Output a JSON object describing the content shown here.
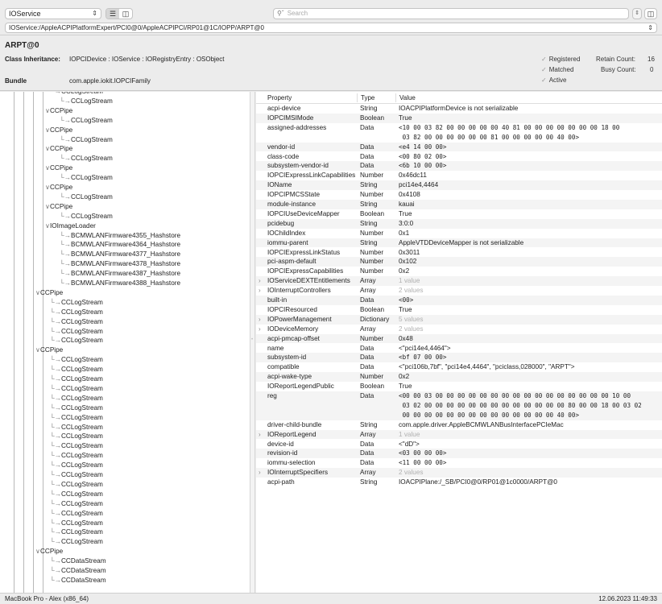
{
  "toolbar": {
    "plane": "IOService",
    "search_placeholder": "Search",
    "path": "IOService:/AppleACPIPlatformExpert/PCI0@0/AppleACPIPCI/RP01@1C/IOPP/ARPT@0"
  },
  "info": {
    "object_name": "ARPT@0",
    "class_inheritance_label": "Class Inheritance:",
    "class_inheritance": "IOPCIDevice : IOService : IORegistryEntry : OSObject",
    "bundle_label": "Bundle",
    "bundle": "com.apple.iokit.IOPCIFamily",
    "flags": [
      "Registered",
      "Matched",
      "Active"
    ],
    "retain_label": "Retain Count:",
    "retain_count": "16",
    "busy_label": "Busy Count:",
    "busy_count": "0"
  },
  "tree": [
    {
      "label": "CCLogStream",
      "depth": 5,
      "twisty": ""
    },
    {
      "label": "CCLogStream",
      "depth": 6,
      "twisty": ""
    },
    {
      "label": "CCPipe",
      "depth": 5,
      "twisty": "open"
    },
    {
      "label": "CCLogStream",
      "depth": 6,
      "twisty": ""
    },
    {
      "label": "CCPipe",
      "depth": 5,
      "twisty": "open"
    },
    {
      "label": "CCLogStream",
      "depth": 6,
      "twisty": ""
    },
    {
      "label": "CCPipe",
      "depth": 5,
      "twisty": "open"
    },
    {
      "label": "CCLogStream",
      "depth": 6,
      "twisty": ""
    },
    {
      "label": "CCPipe",
      "depth": 5,
      "twisty": "open"
    },
    {
      "label": "CCLogStream",
      "depth": 6,
      "twisty": ""
    },
    {
      "label": "CCPipe",
      "depth": 5,
      "twisty": "open"
    },
    {
      "label": "CCLogStream",
      "depth": 6,
      "twisty": ""
    },
    {
      "label": "CCPipe",
      "depth": 5,
      "twisty": "open"
    },
    {
      "label": "CCLogStream",
      "depth": 6,
      "twisty": ""
    },
    {
      "label": "IOImageLoader",
      "depth": 5,
      "twisty": "open"
    },
    {
      "label": "BCMWLANFirmware4355_Hashstore",
      "depth": 6,
      "twisty": ""
    },
    {
      "label": "BCMWLANFirmware4364_Hashstore",
      "depth": 6,
      "twisty": ""
    },
    {
      "label": "BCMWLANFirmware4377_Hashstore",
      "depth": 6,
      "twisty": ""
    },
    {
      "label": "BCMWLANFirmware4378_Hashstore",
      "depth": 6,
      "twisty": ""
    },
    {
      "label": "BCMWLANFirmware4387_Hashstore",
      "depth": 6,
      "twisty": ""
    },
    {
      "label": "BCMWLANFirmware4388_Hashstore",
      "depth": 6,
      "twisty": ""
    },
    {
      "label": "CCPipe",
      "depth": 4,
      "twisty": "open"
    },
    {
      "label": "CCLogStream",
      "depth": 5,
      "twisty": ""
    },
    {
      "label": "CCLogStream",
      "depth": 5,
      "twisty": ""
    },
    {
      "label": "CCLogStream",
      "depth": 5,
      "twisty": ""
    },
    {
      "label": "CCLogStream",
      "depth": 5,
      "twisty": ""
    },
    {
      "label": "CCLogStream",
      "depth": 5,
      "twisty": ""
    },
    {
      "label": "CCPipe",
      "depth": 4,
      "twisty": "open"
    },
    {
      "label": "CCLogStream",
      "depth": 5,
      "twisty": ""
    },
    {
      "label": "CCLogStream",
      "depth": 5,
      "twisty": ""
    },
    {
      "label": "CCLogStream",
      "depth": 5,
      "twisty": ""
    },
    {
      "label": "CCLogStream",
      "depth": 5,
      "twisty": ""
    },
    {
      "label": "CCLogStream",
      "depth": 5,
      "twisty": ""
    },
    {
      "label": "CCLogStream",
      "depth": 5,
      "twisty": ""
    },
    {
      "label": "CCLogStream",
      "depth": 5,
      "twisty": ""
    },
    {
      "label": "CCLogStream",
      "depth": 5,
      "twisty": ""
    },
    {
      "label": "CCLogStream",
      "depth": 5,
      "twisty": ""
    },
    {
      "label": "CCLogStream",
      "depth": 5,
      "twisty": ""
    },
    {
      "label": "CCLogStream",
      "depth": 5,
      "twisty": ""
    },
    {
      "label": "CCLogStream",
      "depth": 5,
      "twisty": ""
    },
    {
      "label": "CCLogStream",
      "depth": 5,
      "twisty": ""
    },
    {
      "label": "CCLogStream",
      "depth": 5,
      "twisty": ""
    },
    {
      "label": "CCLogStream",
      "depth": 5,
      "twisty": ""
    },
    {
      "label": "CCLogStream",
      "depth": 5,
      "twisty": ""
    },
    {
      "label": "CCLogStream",
      "depth": 5,
      "twisty": ""
    },
    {
      "label": "CCLogStream",
      "depth": 5,
      "twisty": ""
    },
    {
      "label": "CCLogStream",
      "depth": 5,
      "twisty": ""
    },
    {
      "label": "CCLogStream",
      "depth": 5,
      "twisty": ""
    },
    {
      "label": "CCPipe",
      "depth": 4,
      "twisty": "open"
    },
    {
      "label": "CCDataStream",
      "depth": 5,
      "twisty": ""
    },
    {
      "label": "CCDataStream",
      "depth": 5,
      "twisty": ""
    },
    {
      "label": "CCDataStream",
      "depth": 5,
      "twisty": ""
    }
  ],
  "table": {
    "headers": {
      "property": "Property",
      "type": "Type",
      "value": "Value"
    },
    "rows": [
      {
        "name": "acpi-device",
        "type": "String",
        "value": "IOACPIPlatformDevice is not serializable",
        "lines": 1
      },
      {
        "name": "IOPCIMSIMode",
        "type": "Boolean",
        "value": "True",
        "lines": 1
      },
      {
        "name": "assigned-addresses",
        "type": "Data",
        "value": "<10 00 03 82 00 00 00 00 00 40 81 00 00 00 00 00 00 00 18 00\n 03 82 00 00 00 00 00 00 81 00 00 00 00 00 40 00>",
        "mono": true,
        "lines": 2
      },
      {
        "name": "vendor-id",
        "type": "Data",
        "value": "<e4 14 00 00>",
        "mono": true,
        "lines": 1
      },
      {
        "name": "class-code",
        "type": "Data",
        "value": "<00 80 02 00>",
        "mono": true,
        "lines": 1
      },
      {
        "name": "subsystem-vendor-id",
        "type": "Data",
        "value": "<6b 10 00 00>",
        "mono": true,
        "lines": 1
      },
      {
        "name": "IOPCIExpressLinkCapabilities",
        "type": "Number",
        "value": "0x46dc11",
        "lines": 1
      },
      {
        "name": "IOName",
        "type": "String",
        "value": "pci14e4,4464",
        "lines": 1
      },
      {
        "name": "IOPCIPMCSState",
        "type": "Number",
        "value": "0x4108",
        "lines": 1
      },
      {
        "name": "module-instance",
        "type": "String",
        "value": "kauai",
        "lines": 1
      },
      {
        "name": "IOPCIUseDeviceMapper",
        "type": "Boolean",
        "value": "True",
        "lines": 1
      },
      {
        "name": "pcidebug",
        "type": "String",
        "value": "3:0:0",
        "lines": 1
      },
      {
        "name": "IOChildIndex",
        "type": "Number",
        "value": "0x1",
        "lines": 1
      },
      {
        "name": "iommu-parent",
        "type": "String",
        "value": "AppleVTDDeviceMapper is not serializable",
        "lines": 1
      },
      {
        "name": "IOPCIExpressLinkStatus",
        "type": "Number",
        "value": "0x3011",
        "lines": 1
      },
      {
        "name": "pci-aspm-default",
        "type": "Number",
        "value": "0x102",
        "lines": 1
      },
      {
        "name": "IOPCIExpressCapabilities",
        "type": "Number",
        "value": "0x2",
        "lines": 1
      },
      {
        "name": "IOServiceDEXTEntitlements",
        "type": "Array",
        "value": "1 value",
        "muted": true,
        "expandable": true,
        "lines": 1
      },
      {
        "name": "IOInterruptControllers",
        "type": "Array",
        "value": "2 values",
        "muted": true,
        "expandable": true,
        "lines": 1
      },
      {
        "name": "built-in",
        "type": "Data",
        "value": "<00>",
        "mono": true,
        "lines": 1
      },
      {
        "name": "IOPCIResourced",
        "type": "Boolean",
        "value": "True",
        "lines": 1
      },
      {
        "name": "IOPowerManagement",
        "type": "Dictionary",
        "value": "5 values",
        "muted": true,
        "expandable": true,
        "lines": 1
      },
      {
        "name": "IODeviceMemory",
        "type": "Array",
        "value": "2 values",
        "muted": true,
        "expandable": true,
        "lines": 1
      },
      {
        "name": "acpi-pmcap-offset",
        "type": "Number",
        "value": "0x48",
        "lines": 1
      },
      {
        "name": "name",
        "type": "Data",
        "value": "<\"pci14e4,4464\">",
        "lines": 1
      },
      {
        "name": "subsystem-id",
        "type": "Data",
        "value": "<bf 07 00 00>",
        "mono": true,
        "lines": 1
      },
      {
        "name": "compatible",
        "type": "Data",
        "value": "<\"pci106b,7bf\", \"pci14e4,4464\", \"pciclass,028000\", \"ARPT\">",
        "lines": 1
      },
      {
        "name": "acpi-wake-type",
        "type": "Number",
        "value": "0x2",
        "lines": 1
      },
      {
        "name": "IOReportLegendPublic",
        "type": "Boolean",
        "value": "True",
        "lines": 1
      },
      {
        "name": "reg",
        "type": "Data",
        "value": "<00 00 03 00 00 00 00 00 00 00 00 00 00 00 00 00 00 00 00 10 00\n 03 02 00 00 00 00 00 00 00 00 00 00 00 00 00 80 00 00 18 00 03 02\n 00 00 00 00 00 00 00 00 00 00 00 00 00 00 40 00>",
        "mono": true,
        "lines": 3
      },
      {
        "name": "driver-child-bundle",
        "type": "String",
        "value": "com.apple.driver.AppleBCMWLANBusInterfacePCIeMac",
        "lines": 1
      },
      {
        "name": "IOReportLegend",
        "type": "Array",
        "value": "1 value",
        "muted": true,
        "expandable": true,
        "lines": 1
      },
      {
        "name": "device-id",
        "type": "Data",
        "value": "<\"dD\">",
        "lines": 1
      },
      {
        "name": "revision-id",
        "type": "Data",
        "value": "<03 00 00 00>",
        "mono": true,
        "lines": 1
      },
      {
        "name": "iommu-selection",
        "type": "Data",
        "value": "<11 00 00 00>",
        "mono": true,
        "lines": 1
      },
      {
        "name": "IOInterruptSpecifiers",
        "type": "Array",
        "value": "2 values",
        "muted": true,
        "expandable": true,
        "lines": 1
      },
      {
        "name": "acpi-path",
        "type": "String",
        "value": "IOACPIPlane:/_SB/PCI0@0/RP01@1c0000/ARPT@0",
        "lines": 1
      }
    ]
  },
  "status": {
    "machine": "MacBook Pro - Alex (x86_64)",
    "timestamp": "12.06.2023 11:49:33"
  }
}
